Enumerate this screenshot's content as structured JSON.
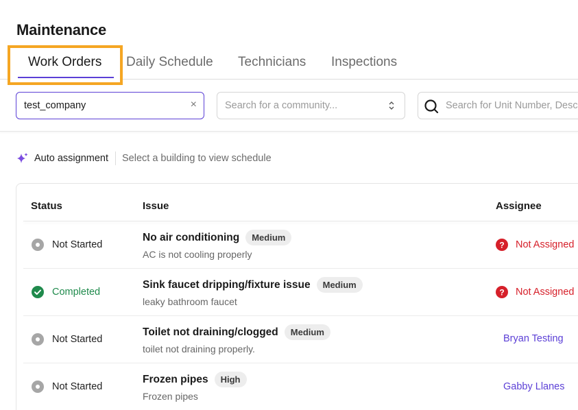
{
  "page": {
    "title": "Maintenance"
  },
  "tabs": [
    {
      "label": "Work Orders",
      "active": true
    },
    {
      "label": "Daily Schedule",
      "active": false
    },
    {
      "label": "Technicians",
      "active": false
    },
    {
      "label": "Inspections",
      "active": false
    }
  ],
  "filters": {
    "company": {
      "value": "test_company",
      "clear_icon": "×"
    },
    "community": {
      "placeholder": "Search for a community..."
    },
    "search": {
      "placeholder": "Search for Unit Number, Desc"
    }
  },
  "auto_assignment": {
    "label": "Auto assignment",
    "hint": "Select a building to view schedule",
    "icon": "sparkle-icon",
    "icon_color": "#7b4de0"
  },
  "table": {
    "columns": {
      "status": "Status",
      "issue": "Issue",
      "assignee": "Assignee"
    },
    "rows": [
      {
        "status": "Not Started",
        "status_type": "not-started",
        "title": "No air conditioning",
        "priority": "Medium",
        "description": "AC is not cooling properly",
        "assignee": "Not Assigned",
        "assigned": false
      },
      {
        "status": "Completed",
        "status_type": "completed",
        "title": "Sink faucet dripping/fixture issue",
        "priority": "Medium",
        "description": "leaky bathroom faucet",
        "assignee": "Not Assigned",
        "assigned": false
      },
      {
        "status": "Not Started",
        "status_type": "not-started",
        "title": "Toilet not draining/clogged",
        "priority": "Medium",
        "description": "toilet not draining properly.",
        "assignee": "Bryan Testing",
        "assigned": true
      },
      {
        "status": "Not Started",
        "status_type": "not-started",
        "title": "Frozen pipes",
        "priority": "High",
        "description": "Frozen pipes",
        "assignee": "Gabby Llanes",
        "assigned": true
      }
    ]
  },
  "colors": {
    "accent": "#5b3fd6",
    "highlight": "#f5a623",
    "completed": "#1f8a4c",
    "unassigned": "#d6202a",
    "not_started": "#a6a6a6"
  }
}
